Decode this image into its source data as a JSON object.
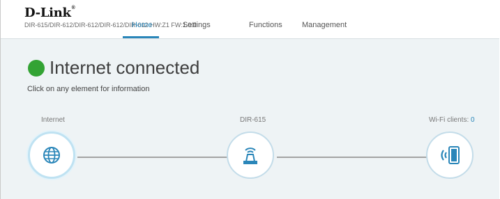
{
  "header": {
    "logo": "D-Link",
    "logo_mark": "®",
    "model_info": "DIR-615/DIR-612/DIR-612/DIR-612/DIR-612 HW:Z1 FW:1.0.0"
  },
  "nav": {
    "home": "Home",
    "settings": "Settings",
    "functions": "Functions",
    "management": "Management"
  },
  "status": {
    "text": "Internet connected",
    "color": "#33a334"
  },
  "hint": "Click on any element for information",
  "nodes": {
    "internet": {
      "label": "Internet",
      "icon": "globe-icon"
    },
    "router": {
      "label": "DIR-615",
      "icon": "router-icon"
    },
    "wifi": {
      "label": "Wi-Fi clients: ",
      "count": "0",
      "icon": "wifi-tablet-icon"
    }
  },
  "colors": {
    "accent": "#2a86b9",
    "background": "#eef3f5"
  }
}
